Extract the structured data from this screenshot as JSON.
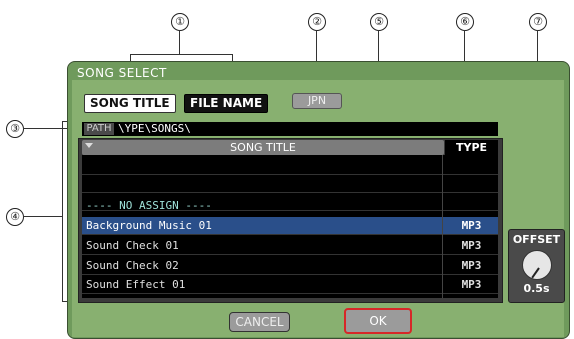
{
  "callouts": [
    "①",
    "②",
    "③",
    "④",
    "⑤",
    "⑥",
    "⑦"
  ],
  "dialog": {
    "title": "SONG SELECT",
    "tabs": [
      {
        "label": "SONG TITLE",
        "active": true
      },
      {
        "label": "FILE NAME",
        "active": false
      }
    ],
    "jpn_label": "JPN",
    "path_label": "PATH",
    "path_value": "\\YPE\\SONGS\\",
    "columns": {
      "title": "SONG TITLE",
      "type": "TYPE"
    },
    "rows": [
      {
        "title": "",
        "type": ""
      },
      {
        "title": "",
        "type": ""
      },
      {
        "title": "---- NO ASSIGN ----",
        "type": ""
      },
      {
        "title": "Background Music 01",
        "type": "MP3",
        "selected": true
      },
      {
        "title": "Sound Check 01",
        "type": "MP3"
      },
      {
        "title": "Sound Check 02",
        "type": "MP3"
      },
      {
        "title": "Sound Effect 01",
        "type": "MP3"
      }
    ],
    "offset": {
      "label": "OFFSET",
      "value": "0.5s"
    },
    "cancel_label": "CANCEL",
    "ok_label": "OK"
  },
  "colors": {
    "dialog_bg": "#6f9a5c",
    "selected_row": "#2a4f8a",
    "ok_border": "#d62828"
  }
}
